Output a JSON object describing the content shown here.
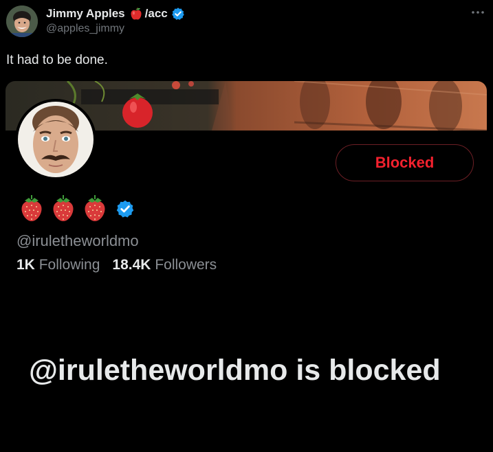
{
  "tweet": {
    "author": {
      "name": "Jimmy Apples",
      "name_suffix": "/acc",
      "handle": "@apples_jimmy",
      "verified": true
    },
    "text": "It had to be done."
  },
  "embedded_profile": {
    "button_label": "Blocked",
    "emoji": [
      "strawberry",
      "strawberry",
      "strawberry"
    ],
    "verified": true,
    "handle": "@iruletheworldmo",
    "following": {
      "count": "1K",
      "label": "Following"
    },
    "followers": {
      "count": "18.4K",
      "label": "Followers"
    },
    "blocked_message": "@iruletheworldmo is blocked"
  },
  "colors": {
    "background": "#000000",
    "text_primary": "#e7e9ea",
    "text_secondary": "#71767b",
    "verified_blue": "#1d9bf0",
    "blocked_red": "#f4212e"
  },
  "icons": {
    "apple": "apple-icon",
    "verified": "verified-badge-icon",
    "more": "more-horizontal-icon",
    "strawberry": "strawberry-icon"
  }
}
